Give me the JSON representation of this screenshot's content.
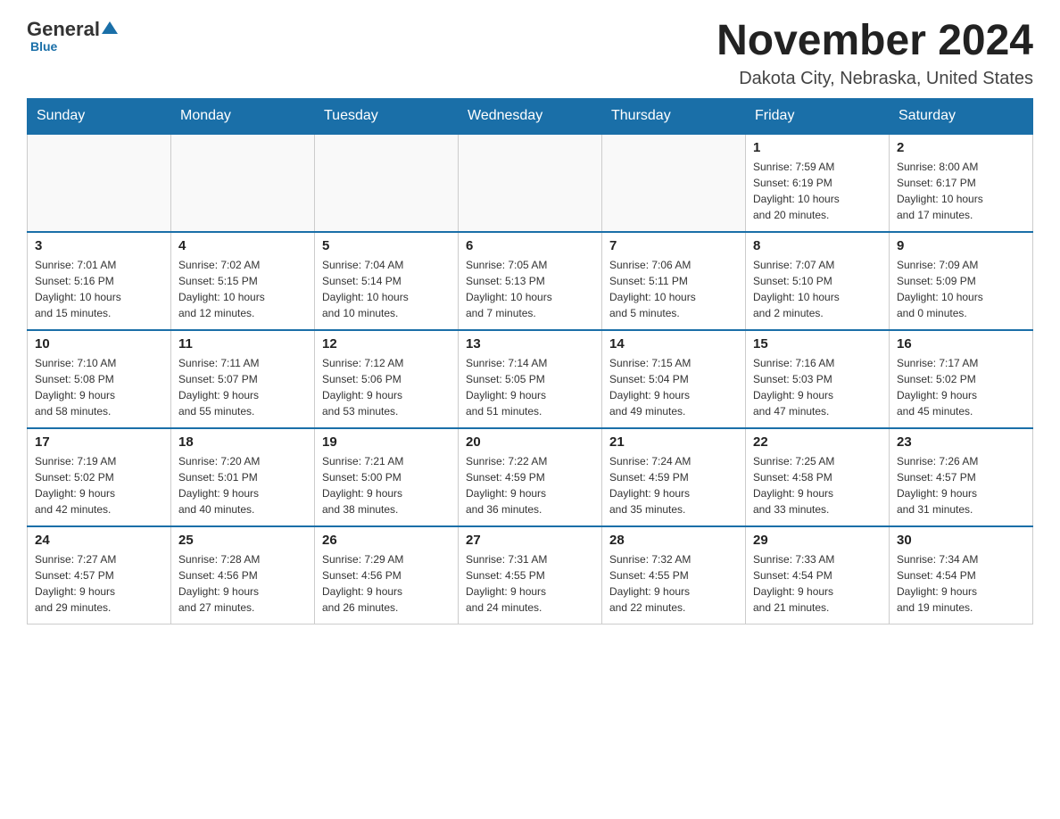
{
  "header": {
    "logo": {
      "general": "General",
      "blue": "Blue",
      "underline": "Blue"
    },
    "title": "November 2024",
    "subtitle": "Dakota City, Nebraska, United States"
  },
  "calendar": {
    "weekdays": [
      "Sunday",
      "Monday",
      "Tuesday",
      "Wednesday",
      "Thursday",
      "Friday",
      "Saturday"
    ],
    "weeks": [
      [
        {
          "day": "",
          "info": ""
        },
        {
          "day": "",
          "info": ""
        },
        {
          "day": "",
          "info": ""
        },
        {
          "day": "",
          "info": ""
        },
        {
          "day": "",
          "info": ""
        },
        {
          "day": "1",
          "info": "Sunrise: 7:59 AM\nSunset: 6:19 PM\nDaylight: 10 hours\nand 20 minutes."
        },
        {
          "day": "2",
          "info": "Sunrise: 8:00 AM\nSunset: 6:17 PM\nDaylight: 10 hours\nand 17 minutes."
        }
      ],
      [
        {
          "day": "3",
          "info": "Sunrise: 7:01 AM\nSunset: 5:16 PM\nDaylight: 10 hours\nand 15 minutes."
        },
        {
          "day": "4",
          "info": "Sunrise: 7:02 AM\nSunset: 5:15 PM\nDaylight: 10 hours\nand 12 minutes."
        },
        {
          "day": "5",
          "info": "Sunrise: 7:04 AM\nSunset: 5:14 PM\nDaylight: 10 hours\nand 10 minutes."
        },
        {
          "day": "6",
          "info": "Sunrise: 7:05 AM\nSunset: 5:13 PM\nDaylight: 10 hours\nand 7 minutes."
        },
        {
          "day": "7",
          "info": "Sunrise: 7:06 AM\nSunset: 5:11 PM\nDaylight: 10 hours\nand 5 minutes."
        },
        {
          "day": "8",
          "info": "Sunrise: 7:07 AM\nSunset: 5:10 PM\nDaylight: 10 hours\nand 2 minutes."
        },
        {
          "day": "9",
          "info": "Sunrise: 7:09 AM\nSunset: 5:09 PM\nDaylight: 10 hours\nand 0 minutes."
        }
      ],
      [
        {
          "day": "10",
          "info": "Sunrise: 7:10 AM\nSunset: 5:08 PM\nDaylight: 9 hours\nand 58 minutes."
        },
        {
          "day": "11",
          "info": "Sunrise: 7:11 AM\nSunset: 5:07 PM\nDaylight: 9 hours\nand 55 minutes."
        },
        {
          "day": "12",
          "info": "Sunrise: 7:12 AM\nSunset: 5:06 PM\nDaylight: 9 hours\nand 53 minutes."
        },
        {
          "day": "13",
          "info": "Sunrise: 7:14 AM\nSunset: 5:05 PM\nDaylight: 9 hours\nand 51 minutes."
        },
        {
          "day": "14",
          "info": "Sunrise: 7:15 AM\nSunset: 5:04 PM\nDaylight: 9 hours\nand 49 minutes."
        },
        {
          "day": "15",
          "info": "Sunrise: 7:16 AM\nSunset: 5:03 PM\nDaylight: 9 hours\nand 47 minutes."
        },
        {
          "day": "16",
          "info": "Sunrise: 7:17 AM\nSunset: 5:02 PM\nDaylight: 9 hours\nand 45 minutes."
        }
      ],
      [
        {
          "day": "17",
          "info": "Sunrise: 7:19 AM\nSunset: 5:02 PM\nDaylight: 9 hours\nand 42 minutes."
        },
        {
          "day": "18",
          "info": "Sunrise: 7:20 AM\nSunset: 5:01 PM\nDaylight: 9 hours\nand 40 minutes."
        },
        {
          "day": "19",
          "info": "Sunrise: 7:21 AM\nSunset: 5:00 PM\nDaylight: 9 hours\nand 38 minutes."
        },
        {
          "day": "20",
          "info": "Sunrise: 7:22 AM\nSunset: 4:59 PM\nDaylight: 9 hours\nand 36 minutes."
        },
        {
          "day": "21",
          "info": "Sunrise: 7:24 AM\nSunset: 4:59 PM\nDaylight: 9 hours\nand 35 minutes."
        },
        {
          "day": "22",
          "info": "Sunrise: 7:25 AM\nSunset: 4:58 PM\nDaylight: 9 hours\nand 33 minutes."
        },
        {
          "day": "23",
          "info": "Sunrise: 7:26 AM\nSunset: 4:57 PM\nDaylight: 9 hours\nand 31 minutes."
        }
      ],
      [
        {
          "day": "24",
          "info": "Sunrise: 7:27 AM\nSunset: 4:57 PM\nDaylight: 9 hours\nand 29 minutes."
        },
        {
          "day": "25",
          "info": "Sunrise: 7:28 AM\nSunset: 4:56 PM\nDaylight: 9 hours\nand 27 minutes."
        },
        {
          "day": "26",
          "info": "Sunrise: 7:29 AM\nSunset: 4:56 PM\nDaylight: 9 hours\nand 26 minutes."
        },
        {
          "day": "27",
          "info": "Sunrise: 7:31 AM\nSunset: 4:55 PM\nDaylight: 9 hours\nand 24 minutes."
        },
        {
          "day": "28",
          "info": "Sunrise: 7:32 AM\nSunset: 4:55 PM\nDaylight: 9 hours\nand 22 minutes."
        },
        {
          "day": "29",
          "info": "Sunrise: 7:33 AM\nSunset: 4:54 PM\nDaylight: 9 hours\nand 21 minutes."
        },
        {
          "day": "30",
          "info": "Sunrise: 7:34 AM\nSunset: 4:54 PM\nDaylight: 9 hours\nand 19 minutes."
        }
      ]
    ]
  }
}
